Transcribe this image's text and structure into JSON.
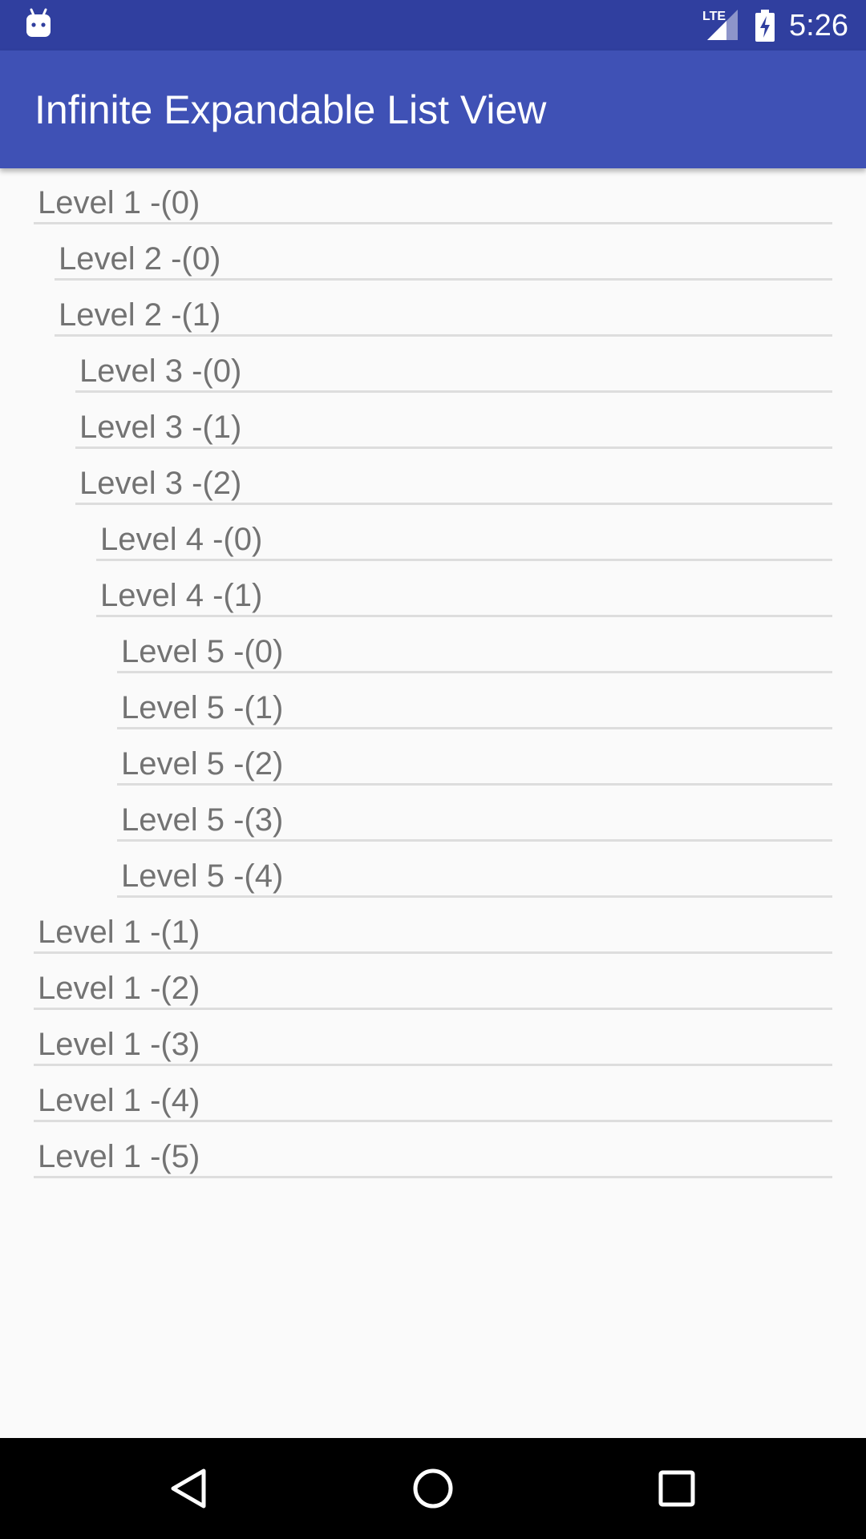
{
  "status_bar": {
    "time": "5:26",
    "network": "LTE",
    "icons": [
      "android-notification-icon",
      "lte-signal-icon",
      "battery-charging-icon"
    ]
  },
  "app_bar": {
    "title": "Infinite Expandable List View"
  },
  "list": {
    "items": [
      {
        "label": "Level 1 -(0)",
        "level": 1
      },
      {
        "label": "Level 2 -(0)",
        "level": 2
      },
      {
        "label": "Level 2 -(1)",
        "level": 2
      },
      {
        "label": "Level 3 -(0)",
        "level": 3
      },
      {
        "label": "Level 3 -(1)",
        "level": 3
      },
      {
        "label": "Level 3 -(2)",
        "level": 3
      },
      {
        "label": "Level 4 -(0)",
        "level": 4
      },
      {
        "label": "Level 4 -(1)",
        "level": 4
      },
      {
        "label": "Level 5 -(0)",
        "level": 5
      },
      {
        "label": "Level 5 -(1)",
        "level": 5
      },
      {
        "label": "Level 5 -(2)",
        "level": 5
      },
      {
        "label": "Level 5 -(3)",
        "level": 5
      },
      {
        "label": "Level 5 -(4)",
        "level": 5
      },
      {
        "label": "Level 1 -(1)",
        "level": 1
      },
      {
        "label": "Level 1 -(2)",
        "level": 1
      },
      {
        "label": "Level 1 -(3)",
        "level": 1
      },
      {
        "label": "Level 1 -(4)",
        "level": 1
      },
      {
        "label": "Level 1 -(5)",
        "level": 1
      }
    ]
  },
  "nav_bar": {
    "buttons": [
      "back-icon",
      "home-icon",
      "recents-icon"
    ]
  },
  "colors": {
    "status_bar": "#303F9F",
    "app_bar": "#3F51B5",
    "background": "#FAFAFA",
    "item_text": "#737373",
    "divider": "#DDDDDD"
  }
}
